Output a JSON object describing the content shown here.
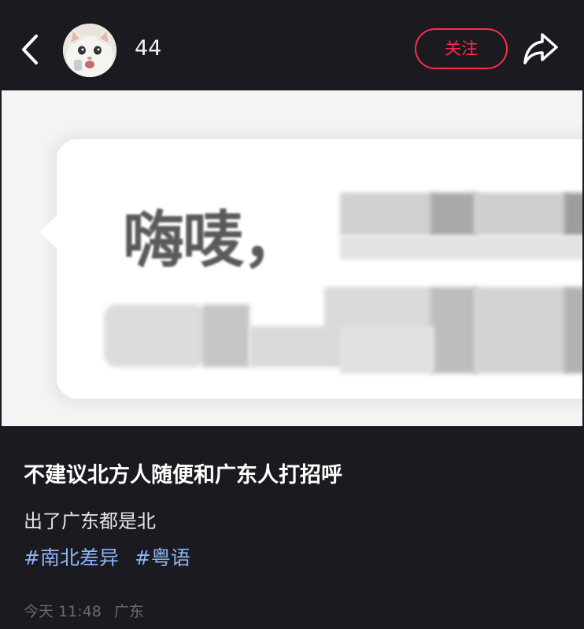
{
  "header": {
    "username": "44",
    "follow_label": "关注",
    "back_icon": "chevron-left-icon",
    "share_icon": "share-arrow-icon",
    "follow_color": "#ff2b4d"
  },
  "image": {
    "visible_text": "嗨唛，"
  },
  "post": {
    "title": "不建议北方人随便和广东人打招呼",
    "description": "出了广东都是北",
    "tags": [
      "#南北差异",
      "#粤语"
    ],
    "time": "今天 11:48",
    "location": "广东",
    "tag_color": "#8db4f6"
  }
}
